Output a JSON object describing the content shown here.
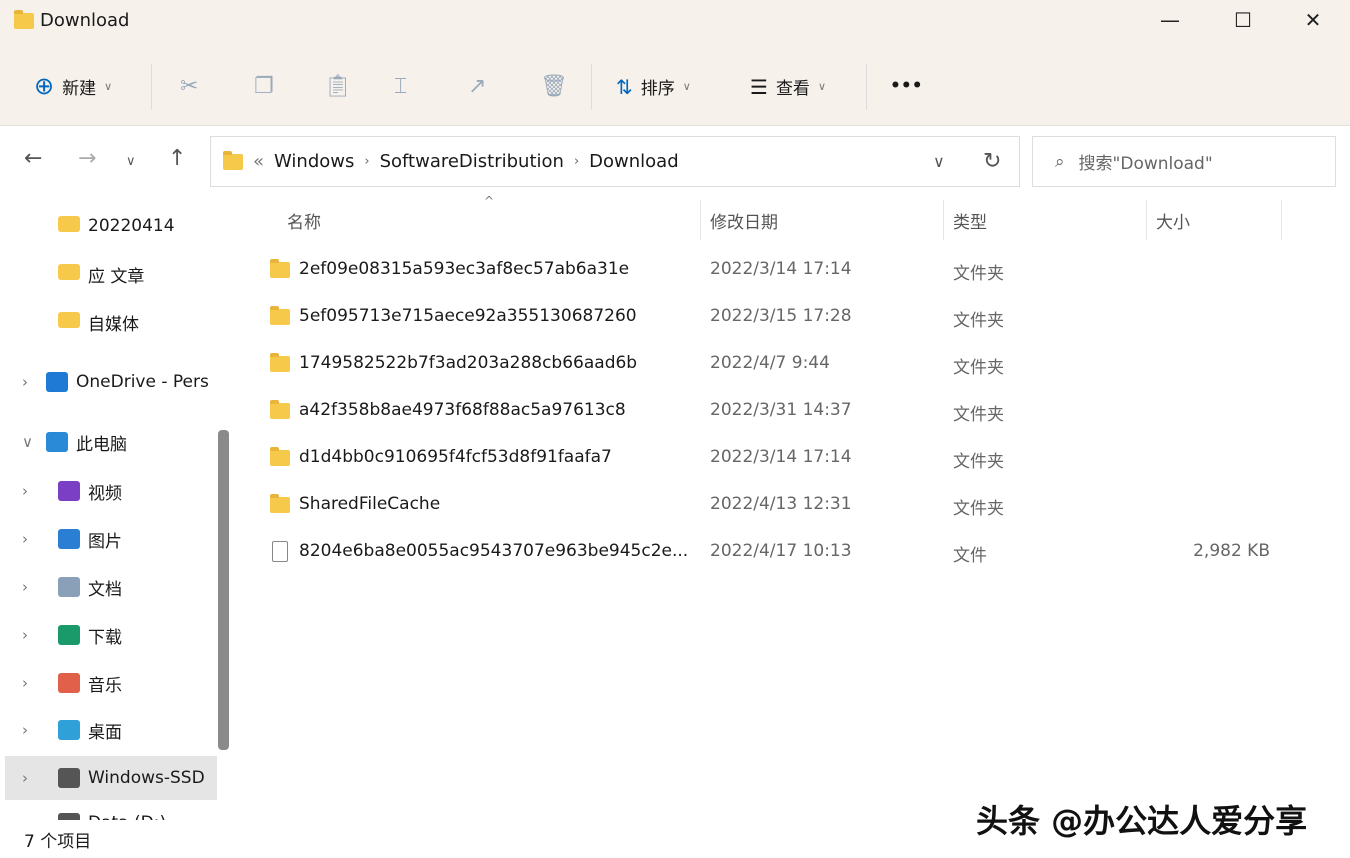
{
  "window": {
    "title": "Download",
    "minimize": "—",
    "maximize": "☐",
    "close": "✕"
  },
  "toolbar": {
    "new": "新建",
    "sort": "排序",
    "view": "查看",
    "more": "•••"
  },
  "address": {
    "crumbs": [
      "Windows",
      "SoftwareDistribution",
      "Download"
    ],
    "overflow": "«"
  },
  "search": {
    "placeholder": "搜索\"Download\""
  },
  "sidebar": {
    "items": [
      {
        "label": "20220414",
        "icon": "folder-icon"
      },
      {
        "label": "应 文章",
        "icon": "folder-icon"
      },
      {
        "label": "自媒体",
        "icon": "folder-icon"
      },
      {
        "label": "OneDrive - Pers",
        "icon": "cloud-icon"
      },
      {
        "label": "此电脑",
        "icon": "computer-icon"
      },
      {
        "label": "视频",
        "icon": "video-icon"
      },
      {
        "label": "图片",
        "icon": "picture-icon"
      },
      {
        "label": "文档",
        "icon": "document-icon"
      },
      {
        "label": "下载",
        "icon": "download-icon"
      },
      {
        "label": "音乐",
        "icon": "music-icon"
      },
      {
        "label": "桌面",
        "icon": "desktop-icon"
      },
      {
        "label": "Windows-SSD",
        "icon": "drive-icon"
      },
      {
        "label": "Data (D:)",
        "icon": "drive-icon"
      }
    ]
  },
  "columns": [
    "名称",
    "修改日期",
    "类型",
    "大小"
  ],
  "files": [
    {
      "name": "2ef09e08315a593ec3af8ec57ab6a31e",
      "date": "2022/3/14 17:14",
      "type": "文件夹",
      "size": ""
    },
    {
      "name": "5ef095713e715aece92a355130687260",
      "date": "2022/3/15 17:28",
      "type": "文件夹",
      "size": ""
    },
    {
      "name": "1749582522b7f3ad203a288cb66aad6b",
      "date": "2022/4/7 9:44",
      "type": "文件夹",
      "size": ""
    },
    {
      "name": "a42f358b8ae4973f68f88ac5a97613c8",
      "date": "2022/3/31 14:37",
      "type": "文件夹",
      "size": ""
    },
    {
      "name": "d1d4bb0c910695f4fcf53d8f91faafa7",
      "date": "2022/3/14 17:14",
      "type": "文件夹",
      "size": ""
    },
    {
      "name": "SharedFileCache",
      "date": "2022/4/13 12:31",
      "type": "文件夹",
      "size": ""
    },
    {
      "name": "8204e6ba8e0055ac9543707e963be945c2e...",
      "date": "2022/4/17 10:13",
      "type": "文件",
      "size": "2,982 KB"
    }
  ],
  "status": {
    "count": "7 个项目"
  },
  "watermark": "头条 @办公达人爱分享"
}
